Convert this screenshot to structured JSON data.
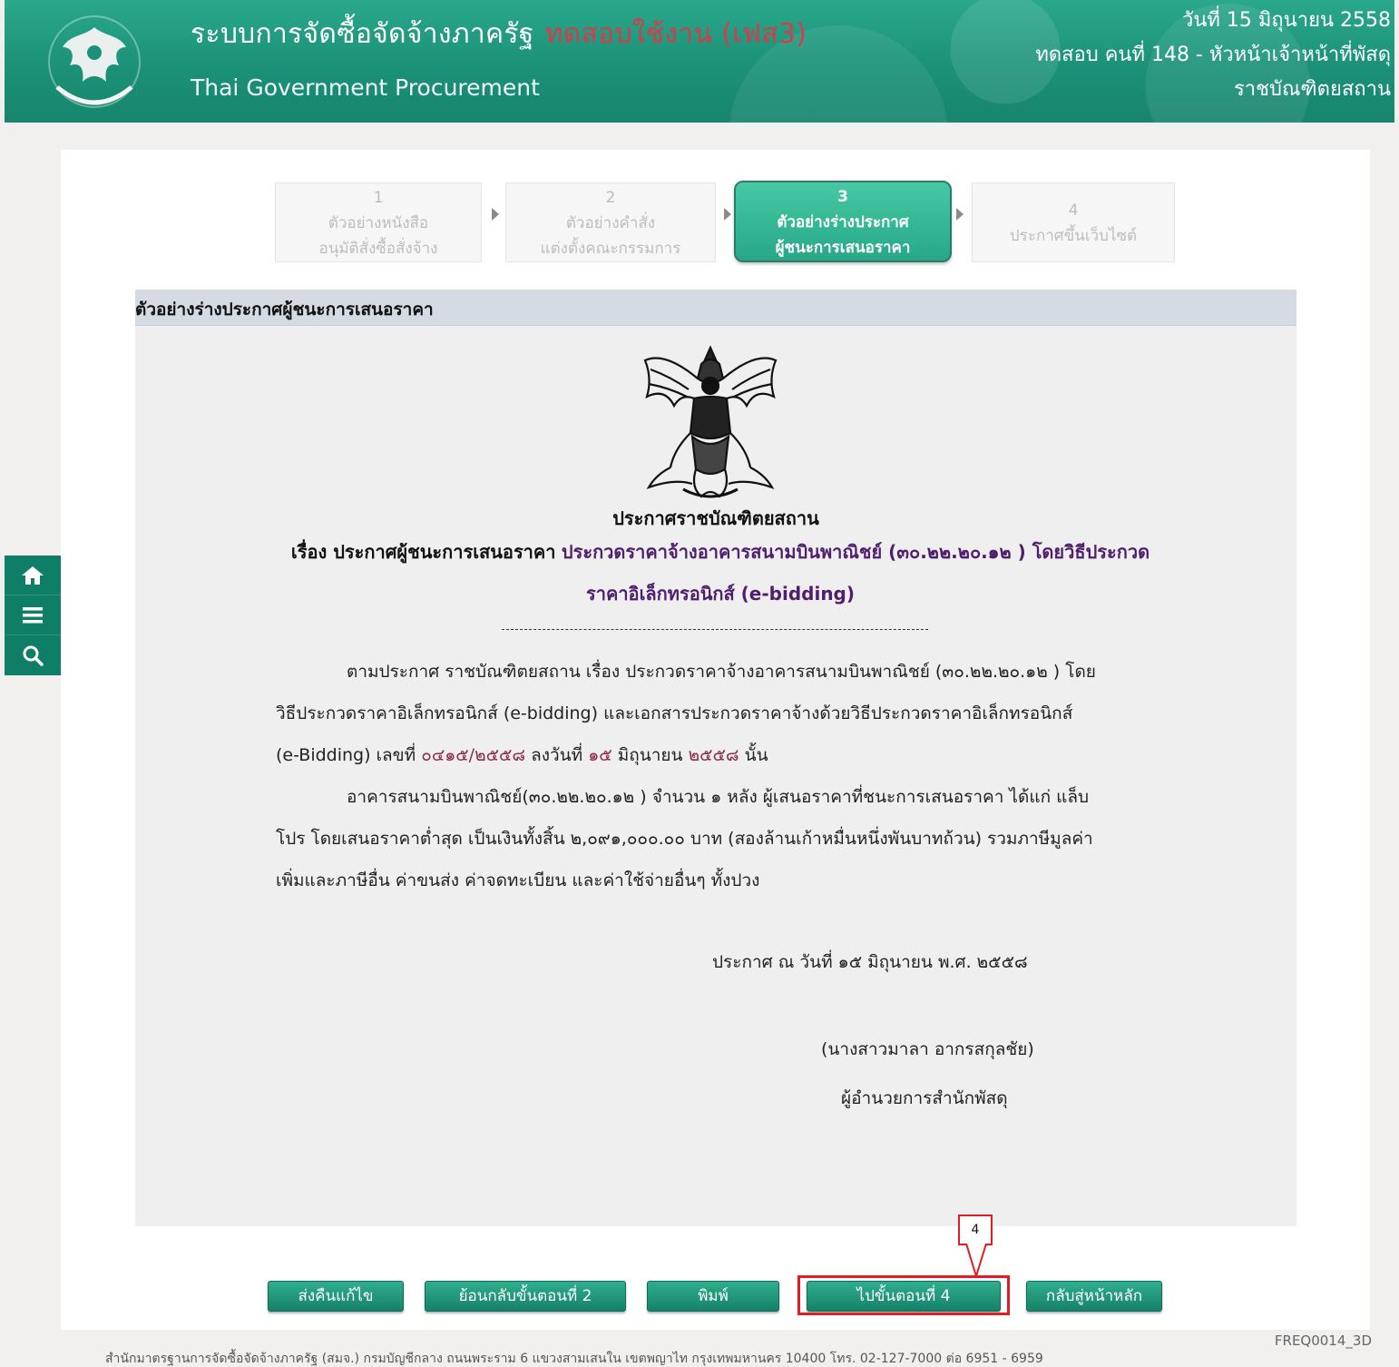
{
  "header": {
    "system_title": "ระบบการจัดซื้อจัดจ้างภาครัฐ",
    "trial_label": "ทดสอบใช้งาน (เฟส3)",
    "subtitle": "Thai Government Procurement",
    "date": "วันที่ 15 มิถุนายน 2558",
    "user": "ทดสอบ คนที่ 148 - หัวหน้าเจ้าหน้าที่พัสดุ",
    "agency": "ราชบัณฑิตยสถาน"
  },
  "steps": [
    {
      "num": "1",
      "line1": "ตัวอย่างหนังสือ",
      "line2": "อนุมัติสั่งซื้อสั่งจ้าง"
    },
    {
      "num": "2",
      "line1": "ตัวอย่างคำสั่ง",
      "line2": "แต่งตั้งคณะกรรมการ"
    },
    {
      "num": "3",
      "line1": "ตัวอย่างร่างประกาศ",
      "line2": "ผู้ชนะการเสนอราคา"
    },
    {
      "num": "4",
      "line1": "ประกาศขึ้นเว็บไซต์",
      "line2": ""
    }
  ],
  "document": {
    "section_title": "ตัวอย่างร่างประกาศผู้ชนะการเสนอราคา",
    "announce_title": "ประกาศราชบัณฑิตยสถาน",
    "subject_prefix": "เรื่อง ประกาศผู้ชนะการเสนอราคา",
    "subject_project": "ประกวดราคาจ้างอาคารสนามบินพาณิชย์ (๓๐.๒๒.๒๐.๑๒ ) โดยวิธีประกวด",
    "subject_line2": "ราคาอิเล็กทรอนิกส์ (e-bidding)",
    "para1_line1": "ตามประกาศ ราชบัณฑิตยสถาน เรื่อง ประกวดราคาจ้างอาคารสนามบินพาณิชย์ (๓๐.๒๒.๒๐.๑๒ ) โดย",
    "para1_line2": "วิธีประกวดราคาอิเล็กทรอนิกส์ (e-bidding) และเอกสารประกวดราคาจ้างด้วยวิธีประกวดราคาอิเล็กทรอนิกส์",
    "para1_line3_pre": "(e-Bidding) เลขที่",
    "doc_no": "๐๔๑๕/๒๕๕๘",
    "para1_line3_mid": "ลงวันที่",
    "doc_date": "๑๕",
    "para1_line3_month": "มิถุนายน",
    "doc_year": "๒๕๕๘",
    "para1_line3_end": "นั้น",
    "para2_line1": "อาคารสนามบินพาณิชย์(๓๐.๒๒.๒๐.๑๒ ) จำนวน ๑ หลัง ผู้เสนอราคาที่ชนะการเสนอราคา ได้แก่ แล็บ",
    "para2_line2": "โปร โดยเสนอราคาต่ำสุด เป็นเงินทั้งสิ้น ๒,๐๙๑,๐๐๐.๐๐ บาท (สองล้านเก้าหมื่นหนึ่งพันบาทถ้วน) รวมภาษีมูลค่า",
    "para2_line3": "เพิ่มและภาษีอื่น ค่าขนส่ง ค่าจดทะเบียน และค่าใช้จ่ายอื่นๆ ทั้งปวง",
    "announce_date": "ประกาศ ณ วันที่ ๑๕ มิถุนายน พ.ศ. ๒๕๕๘",
    "signer_name": "(นางสาวมาลา อากรสกุลชัย)",
    "signer_position": "ผู้อำนวยการสำนักพัสดุ"
  },
  "buttons": {
    "return_edit": "ส่งคืนแก้ไข",
    "back_step2": "ย้อนกลับขั้นตอนที่ 2",
    "print": "พิมพ์",
    "next_step4": "ไปขั้นตอนที่ 4",
    "home": "กลับสู่หน้าหลัก"
  },
  "annotation": {
    "callout_number": "4"
  },
  "footer": {
    "page_code": "FREQ0014_3D",
    "address": "สำนักมาตรฐานการจัดซื้อจัดจ้างภาครัฐ (สมจ.) กรมบัญชีกลาง ถนนพระราม 6 แขวงสามเสนใน เขตพญาไท กรุงเทพมหานคร 10400 โทร. 02-127-7000 ต่อ 6951 - 6959"
  },
  "icons": [
    "home-icon",
    "menu-icon",
    "search-icon"
  ],
  "colors": {
    "header": "#1b9178",
    "button": "#168168",
    "highlight": "#e31c23",
    "trial": "#d83b4a"
  }
}
